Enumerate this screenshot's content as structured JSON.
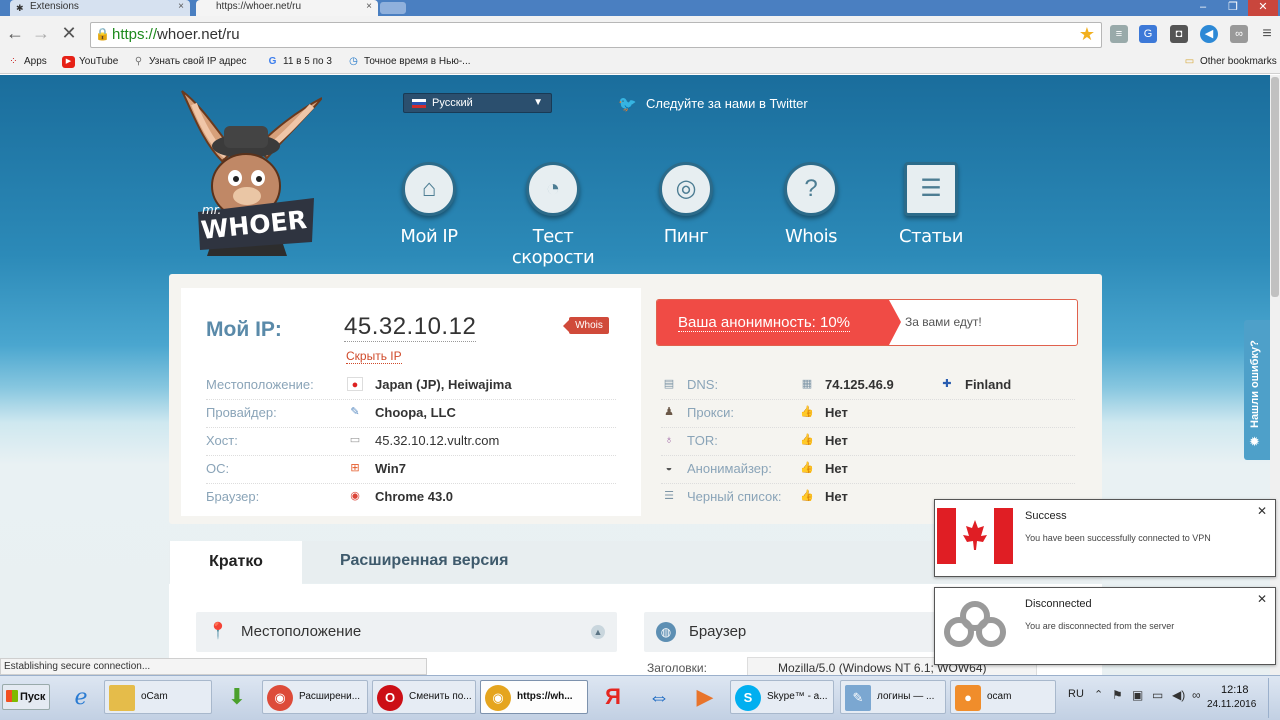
{
  "browser": {
    "tabs": [
      {
        "label": "Extensions",
        "active": false
      },
      {
        "label": "https://whoer.net/ru",
        "active": true
      }
    ],
    "url": {
      "scheme": "https://",
      "rest": "whoer.net/ru"
    },
    "bookmarks": [
      {
        "label": "Apps",
        "icon": "apps-grid-icon"
      },
      {
        "label": "YouTube",
        "icon": "youtube-icon"
      },
      {
        "label": "Узнать свой IP адрес",
        "icon": "search-icon"
      },
      {
        "label": "11 в 5 по 3",
        "icon": "google-icon"
      },
      {
        "label": "Точное время в Нью-...",
        "icon": "clock-icon"
      }
    ],
    "other_bookmarks": "Other bookmarks",
    "status_text": "Establishing secure connection..."
  },
  "site": {
    "logo_small": "mr.",
    "logo_big": "WHOER",
    "language": "Русский",
    "twitter": "Следуйте за нами в Twitter",
    "nav": [
      {
        "label": "Мой IP",
        "icon": "house-icon"
      },
      {
        "label": "Тест скорости",
        "icon": "speedometer-icon"
      },
      {
        "label": "Пинг",
        "icon": "ping-icon"
      },
      {
        "label": "Whois",
        "icon": "question-icon"
      },
      {
        "label": "Статьи",
        "icon": "article-icon"
      }
    ],
    "my_ip_label": "Мой IP:",
    "my_ip": "45.32.10.12",
    "hide_ip": "Скрыть IP",
    "whois_tag": "Whois",
    "left_rows": [
      {
        "label": "Местоположение:",
        "value": "Japan (JP), Heiwajima",
        "icon": "japan-flag-icon"
      },
      {
        "label": "Провайдер:",
        "value": "Choopa, LLC",
        "icon": "provider-icon"
      },
      {
        "label": "Хост:",
        "value": "45.32.10.12.vultr.com",
        "icon": "server-icon"
      },
      {
        "label": "ОС:",
        "value": "Win7",
        "icon": "windows-icon"
      },
      {
        "label": "Браузер:",
        "value": "Chrome 43.0",
        "icon": "chrome-icon"
      }
    ],
    "anonymity": "Ваша анонимность: 10%",
    "anonymity_percent": 10,
    "anonymity_msg": "За вами едут!",
    "right_rows": [
      {
        "label": "DNS:",
        "value": "74.125.46.9",
        "extra": "Finland",
        "icon": "dns-icon"
      },
      {
        "label": "Прокси:",
        "value": "Нет",
        "icon": "spy-icon"
      },
      {
        "label": "TOR:",
        "value": "Нет",
        "icon": "onion-icon"
      },
      {
        "label": "Анонимайзер:",
        "value": "Нет",
        "icon": "mask-icon"
      },
      {
        "label": "Черный список:",
        "value": "Нет",
        "icon": "list-icon"
      }
    ],
    "tab_short": "Кратко",
    "tab_full": "Расширенная версия",
    "section_location": "Местоположение",
    "section_browser": "Браузер",
    "headers_label": "Заголовки:",
    "user_agent": "Mozilla/5.0 (Windows NT 6.1; WOW64)",
    "feedback": "Нашли ошибку?"
  },
  "notifications": [
    {
      "title": "Success",
      "body": "You have been successfully connected to VPN",
      "image": "canada-flag"
    },
    {
      "title": "Disconnected",
      "body": "You are disconnected from the server",
      "image": "vpn-logo"
    }
  ],
  "taskbar": {
    "start": "Пуск",
    "items": [
      {
        "label": "oCam",
        "icon": "folder-icon"
      },
      {
        "label": "Расширени...",
        "icon": "chrome-icon"
      },
      {
        "label": "Сменить по...",
        "icon": "opera-icon"
      },
      {
        "label": "https://wh...",
        "icon": "chrome-icon"
      },
      {
        "label": "Skype™ - a...",
        "icon": "skype-icon"
      },
      {
        "label": "логины — ...",
        "icon": "notepad-icon"
      },
      {
        "label": "ocam",
        "icon": "ocam-icon"
      }
    ],
    "lang": "RU",
    "time": "12:18",
    "date": "24.11.2016"
  },
  "colors": {
    "accent_red": "#f04b45",
    "link_blue": "#5a8aa9",
    "header_blue": "#1a6d9c"
  }
}
